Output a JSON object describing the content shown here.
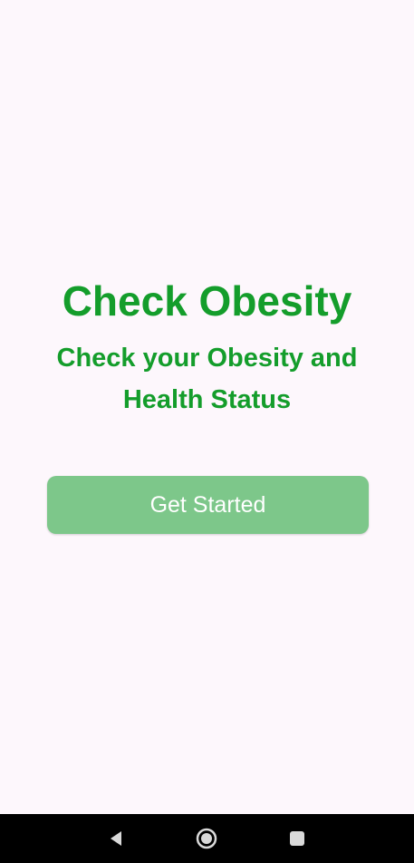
{
  "welcome": {
    "title": "Check Obesity",
    "subtitle": "Check your Obesity and Health Status",
    "get_started_label": "Get Started"
  },
  "system_nav": {
    "back_icon": "back-triangle-icon",
    "home_icon": "home-circle-icon",
    "recents_icon": "recents-square-icon"
  },
  "colors": {
    "background": "#fdf7fc",
    "accent_green": "#149d2b",
    "button_green": "#7dc78a",
    "button_text": "#ffffff",
    "nav_bar": "#000000"
  }
}
